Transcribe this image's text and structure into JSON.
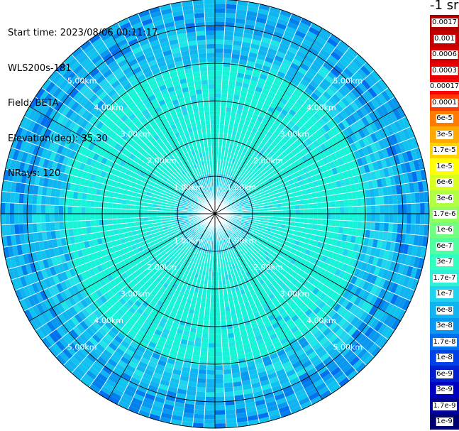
{
  "header": {
    "start_time": "Start time: 2023/08/06 00:11:17",
    "instrument": "WLS200s-181",
    "field": "Field: BETA",
    "elevation": "Elevation(deg): 35.30",
    "nrays": "NRays: 120"
  },
  "colorbar": {
    "unit_label": "-1 sr",
    "levels": [
      {
        "label": "0.0017",
        "color": "#b00000"
      },
      {
        "label": "0.001",
        "color": "#c20000"
      },
      {
        "label": "0.0006",
        "color": "#d40000"
      },
      {
        "label": "0.0003",
        "color": "#e60000"
      },
      {
        "label": "0.00017",
        "color": "#ff0000"
      },
      {
        "label": "0.0001",
        "color": "#ff3a00"
      },
      {
        "label": "6e-5",
        "color": "#ff7a00"
      },
      {
        "label": "3e-5",
        "color": "#ffaa00"
      },
      {
        "label": "1.7e-5",
        "color": "#ffd200"
      },
      {
        "label": "1e-5",
        "color": "#ffff00"
      },
      {
        "label": "6e-6",
        "color": "#d8ff20"
      },
      {
        "label": "3e-6",
        "color": "#b0ff40"
      },
      {
        "label": "1.7e-6",
        "color": "#90ff60"
      },
      {
        "label": "1e-6",
        "color": "#70ff80"
      },
      {
        "label": "6e-7",
        "color": "#50ffa0"
      },
      {
        "label": "3e-7",
        "color": "#30ffc0"
      },
      {
        "label": "1.7e-7",
        "color": "#30f0d8"
      },
      {
        "label": "1e-7",
        "color": "#20d4f0"
      },
      {
        "label": "6e-8",
        "color": "#10b4f0"
      },
      {
        "label": "3e-8",
        "color": "#0898f0"
      },
      {
        "label": "1.7e-8",
        "color": "#0070f0"
      },
      {
        "label": "1e-8",
        "color": "#0040e8"
      },
      {
        "label": "6e-9",
        "color": "#0020d0"
      },
      {
        "label": "3e-9",
        "color": "#0000c0"
      },
      {
        "label": "1.7e-9",
        "color": "#00009a"
      },
      {
        "label": "1e-9",
        "color": "#000070"
      }
    ]
  },
  "chart_data": {
    "type": "ppi",
    "field": "BETA",
    "elevation_deg": 35.3,
    "nrays": 120,
    "max_range_km": 5.7,
    "range_rings_km": [
      1,
      2,
      3,
      4,
      5
    ],
    "range_ring_labels": [
      "1.00km",
      "2.00km",
      "3.00km",
      "4.00km",
      "5.00km"
    ],
    "azimuth_lines_deg": [
      0,
      30,
      60,
      90,
      120,
      150,
      180,
      210,
      240,
      270,
      300,
      330
    ],
    "dominant_values_by_range": [
      {
        "range_km": [
          0.0,
          1.0
        ],
        "value": "6e-8 to 1e-7"
      },
      {
        "range_km": [
          1.0,
          2.0
        ],
        "value": "1.7e-7 to 3e-7"
      },
      {
        "range_km": [
          2.0,
          3.0
        ],
        "value": "1.7e-7 to 3e-7"
      },
      {
        "range_km": [
          3.0,
          4.0
        ],
        "value": "1e-7 to 1.7e-7"
      },
      {
        "range_km": [
          4.0,
          5.0
        ],
        "value": "3e-8 to 1e-7"
      },
      {
        "range_km": [
          5.0,
          5.7
        ],
        "value": "1.7e-8 to 6e-8"
      }
    ]
  }
}
